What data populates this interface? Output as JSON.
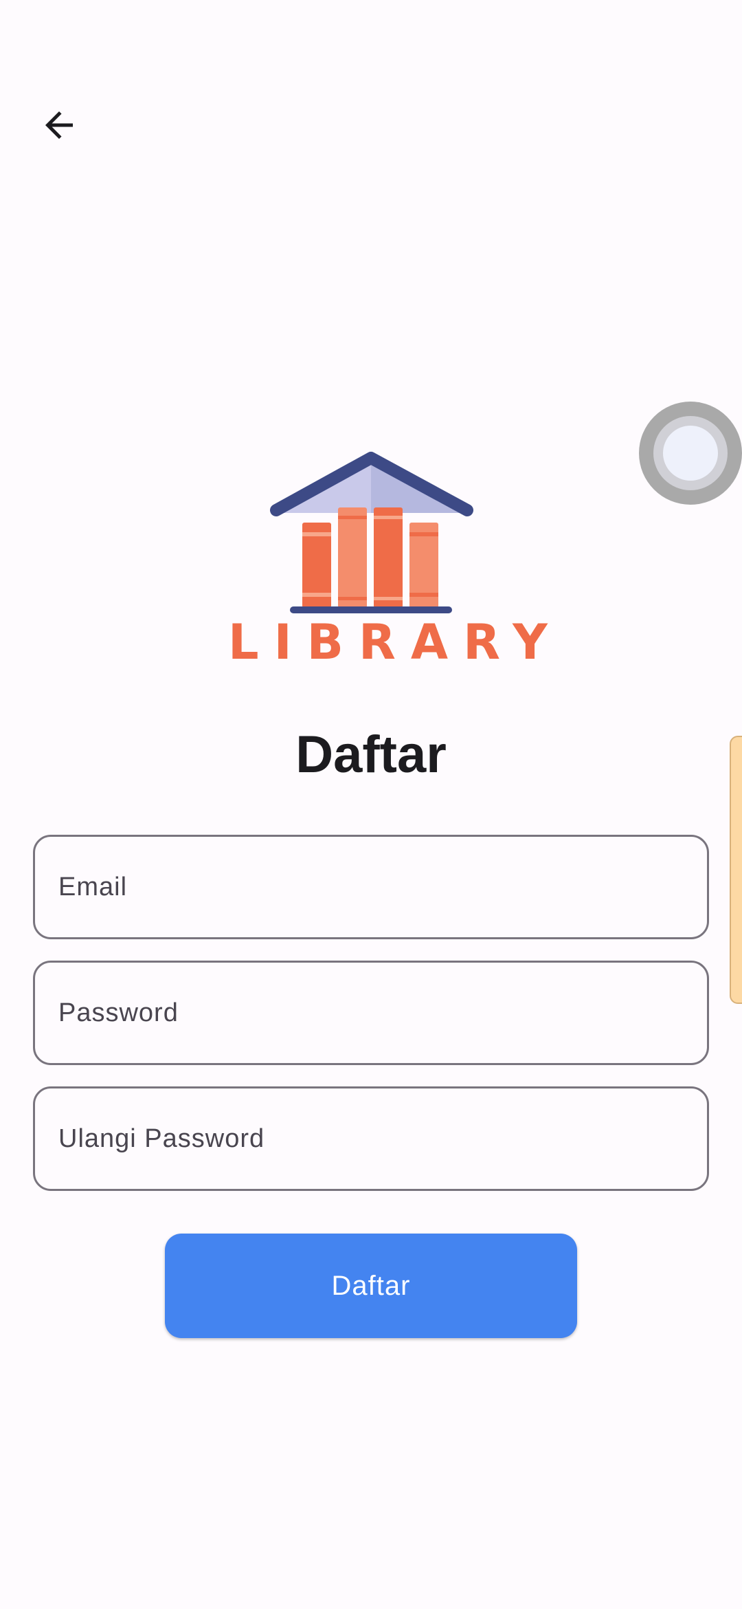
{
  "header": {
    "back_icon": "arrow-left-icon"
  },
  "logo": {
    "wordmark": "LIBRARY",
    "colors": {
      "roof": "#3d4a86",
      "roof_inner": "#c9c9ea",
      "book_dark": "#ef6c48",
      "book_light": "#f48d6c"
    }
  },
  "page": {
    "title": "Daftar"
  },
  "form": {
    "email_placeholder": "Email",
    "password_placeholder": "Password",
    "confirm_password_placeholder": "Ulangi Password",
    "submit_label": "Daftar"
  },
  "colors": {
    "accent": "#4484f0",
    "background": "#fefbfe",
    "field_border": "#79747e"
  }
}
